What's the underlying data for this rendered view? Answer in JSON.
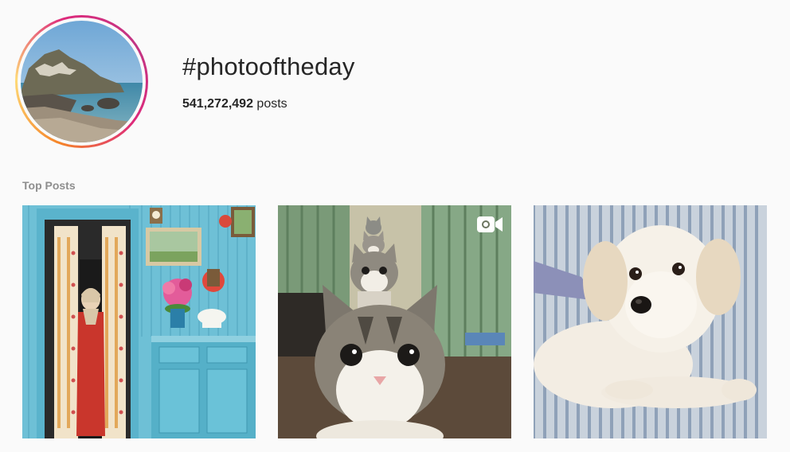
{
  "header": {
    "hashtag": "#photooftheday",
    "post_count": "541,272,492",
    "post_count_suffix": " posts"
  },
  "sections": {
    "top_posts_title": "Top Posts"
  },
  "posts": [
    {
      "subject": "woman in doorway of blue room",
      "media_type": "image"
    },
    {
      "subject": "stacked cats",
      "media_type": "video",
      "icon": "video-camera-icon"
    },
    {
      "subject": "white fluffy dog on striped sofa",
      "media_type": "image"
    }
  ],
  "colors": {
    "background": "#fafafa",
    "text": "#262626",
    "muted_text": "#8e8e8e",
    "ring_gradient": [
      "#f58529",
      "#dd2a7b",
      "#c13584"
    ]
  }
}
